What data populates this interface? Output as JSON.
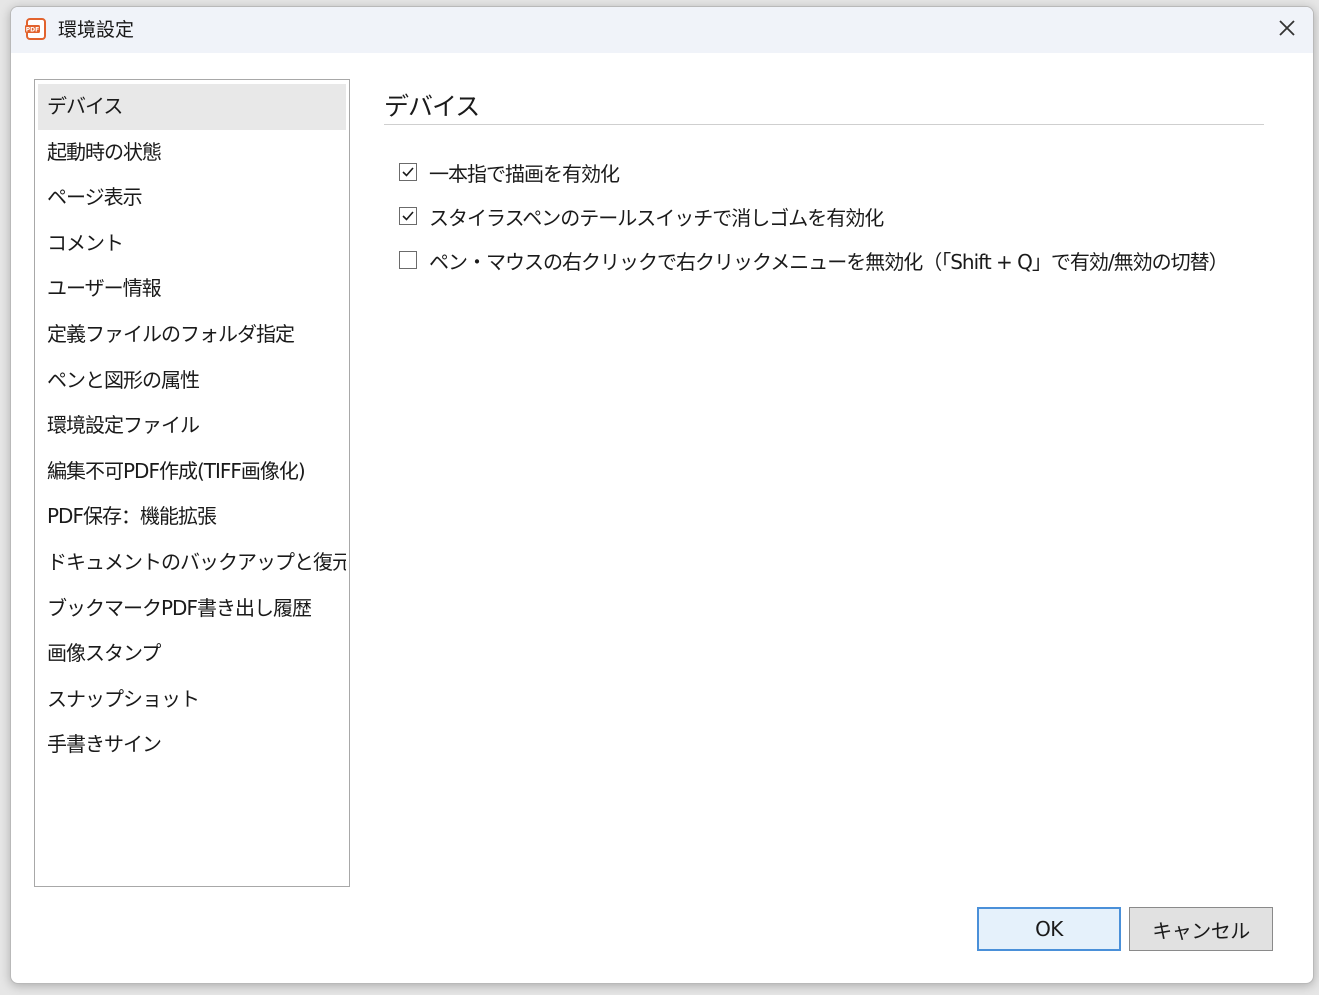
{
  "window": {
    "title": "環境設定",
    "app_icon": "pdf-app-icon",
    "close_icon": "close-icon"
  },
  "sidebar": {
    "items": [
      {
        "label": "デバイス",
        "selected": true
      },
      {
        "label": "起動時の状態",
        "selected": false
      },
      {
        "label": "ページ表示",
        "selected": false
      },
      {
        "label": "コメント",
        "selected": false
      },
      {
        "label": "ユーザー情報",
        "selected": false
      },
      {
        "label": "定義ファイルのフォルダ指定",
        "selected": false
      },
      {
        "label": "ペンと図形の属性",
        "selected": false
      },
      {
        "label": "環境設定ファイル",
        "selected": false
      },
      {
        "label": "編集不可PDF作成(TIFF画像化)",
        "selected": false
      },
      {
        "label": "PDF保存：機能拡張",
        "selected": false
      },
      {
        "label": "ドキュメントのバックアップと復元",
        "selected": false
      },
      {
        "label": "ブックマークPDF書き出し履歴",
        "selected": false
      },
      {
        "label": "画像スタンプ",
        "selected": false
      },
      {
        "label": "スナップショット",
        "selected": false
      },
      {
        "label": "手書きサイン",
        "selected": false
      }
    ]
  },
  "content": {
    "heading": "デバイス",
    "options": [
      {
        "label": "一本指で描画を有効化",
        "checked": true
      },
      {
        "label": "スタイラスペンのテールスイッチで消しゴムを有効化",
        "checked": true
      },
      {
        "label": "ペン・マウスの右クリックで右クリックメニューを無効化（「Shift + Q」で有効/無効の切替）",
        "checked": false
      }
    ]
  },
  "buttons": {
    "ok_label": "OK",
    "cancel_label": "キャンセル"
  },
  "colors": {
    "titlebar_bg": "#f0f3f9",
    "selected_item_bg": "#e8e8e8",
    "ok_border": "#4a90d9",
    "icon_accent": "#e2632e"
  }
}
